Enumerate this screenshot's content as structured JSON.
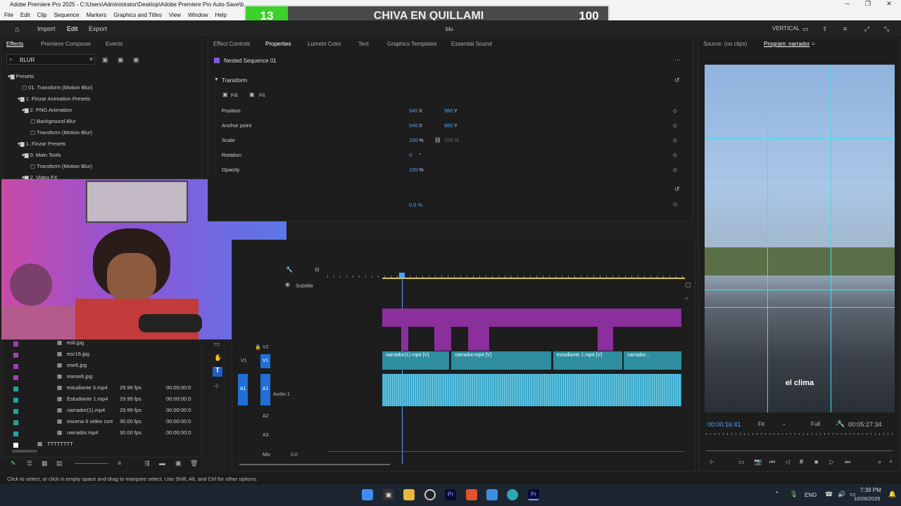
{
  "window": {
    "title": "Adobe Premiere Pro 2025 - C:\\Users\\Administrator\\Desktop\\Adobe Premiere Pro Auto-Save\\b"
  },
  "menu": [
    "File",
    "Edit",
    "Clip",
    "Sequence",
    "Markers",
    "Graphics and Titles",
    "View",
    "Window",
    "Help"
  ],
  "appbar": {
    "import": "Import",
    "edit": "Edit",
    "export": "Export",
    "center": "blu",
    "workspace": "VERTICAL"
  },
  "overlay": {
    "left_score": "13",
    "title": "CHIVA EN QUILLAMI",
    "right_score": "100",
    "left_color": "#3bd12a"
  },
  "effects": {
    "tabs": [
      "Effects",
      "Premiere Composer",
      "Events"
    ],
    "search_value": "BLUR",
    "tree": [
      "Presets",
      "01. Transform (Motion Blur)",
      "1. Finzar Animation Presets",
      "2. PNG Animation",
      "Background Blur",
      "Transform (Motion Blur)",
      "1. Finzar Presets",
      "0. Main Tools",
      "Transform (Motion Blur)",
      "2. Video FX"
    ]
  },
  "project": {
    "items": [
      {
        "name": "es8.jpg",
        "fps": "",
        "time": ""
      },
      {
        "name": "esc16.jpg",
        "fps": "",
        "time": ""
      },
      {
        "name": "ese6.jpg",
        "fps": "",
        "time": ""
      },
      {
        "name": "esese6.jpg",
        "fps": "",
        "time": ""
      },
      {
        "name": "estudiante 3.mp4",
        "fps": "29.96 fps",
        "time": "00:00:00:0"
      },
      {
        "name": "Estudiante 1.mp4",
        "fps": "29.99 fps",
        "time": "00:00:00:0"
      },
      {
        "name": "narrador(1).mp4",
        "fps": "29.99 fps",
        "time": "00:00:00:0"
      },
      {
        "name": "escena 6 video cort",
        "fps": "30.00 fps",
        "time": "00:00:00:0"
      },
      {
        "name": "narrador.mp4",
        "fps": "30.00 fps",
        "time": "00:00:00:0"
      },
      {
        "name": "TTTTTTTT",
        "fps": "",
        "time": ""
      }
    ]
  },
  "properties": {
    "tabs": [
      "Effect Controls",
      "Properties",
      "Lumetri Color",
      "Text",
      "Graphics Templates",
      "Essential Sound"
    ],
    "clip": "Nested Sequence 01",
    "section": "Transform",
    "fill": "Fill",
    "fit": "Fit",
    "params": [
      {
        "label": "Position",
        "v1": "540",
        "u1": "X",
        "v2": "960",
        "u2": "Y"
      },
      {
        "label": "Anchor point",
        "v1": "540",
        "u1": "X",
        "v2": "960",
        "u2": "Y"
      },
      {
        "label": "Scale",
        "v1": "100",
        "u1": "%",
        "v2": "100 %",
        "u2": ""
      },
      {
        "label": "Rotation",
        "v1": "0",
        "u1": "°",
        "v2": "",
        "u2": ""
      },
      {
        "label": "Opacity",
        "v1": "100",
        "u1": "%",
        "v2": "",
        "u2": ""
      }
    ],
    "extra_value": "0.0 %"
  },
  "timeline": {
    "subtitle": "Subtitle",
    "tracks": [
      "V2",
      "V1",
      "A1",
      "A2",
      "A3"
    ],
    "audio_name": "Audio 1",
    "mix": "Mix",
    "mix_value": "0.0",
    "clips": [
      "narrador(1).mp4 [V]",
      "narrador.mp4 [V]",
      "estudiante 1.mp4 [V]",
      "narrador..."
    ]
  },
  "program": {
    "source_tab": "Source: (no clips)",
    "program_tab": "Program: narrador",
    "caption": "el clima",
    "timecode": "00:00:16:41",
    "fit": "Fit",
    "quality": "Full",
    "duration": "00:05:27:34"
  },
  "status": "Click to select, or click in empty space and drag to marquee select. Use Shift, Alt, and Ctrl for other options.",
  "tray": {
    "lang": "ENG",
    "time": "7:39 PM",
    "date": "10/26/2025"
  }
}
